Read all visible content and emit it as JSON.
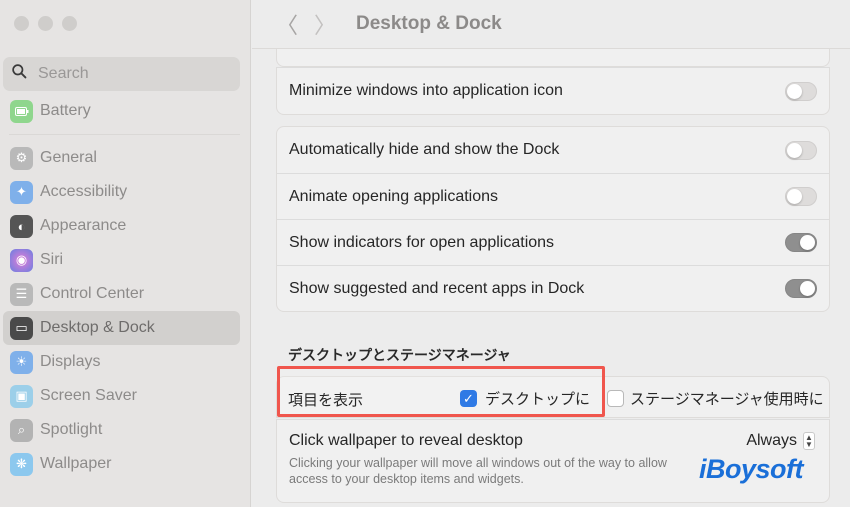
{
  "sidebar": {
    "search_placeholder": "Search",
    "items": [
      {
        "label": "Battery",
        "icon": "battery-icon",
        "color": "#5cc85a"
      },
      {
        "label": "General",
        "icon": "gear-icon",
        "color": "#9a9a9a"
      },
      {
        "label": "Accessibility",
        "icon": "accessibility-icon",
        "color": "#3d8ff0"
      },
      {
        "label": "Appearance",
        "icon": "appearance-icon",
        "color": "#2a2a2a"
      },
      {
        "label": "Siri",
        "icon": "siri-icon",
        "color": "#c04fd6"
      },
      {
        "label": "Control Center",
        "icon": "control-center-icon",
        "color": "#9a9a9a"
      },
      {
        "label": "Desktop & Dock",
        "icon": "dock-icon",
        "color": "#2a2a2a"
      },
      {
        "label": "Displays",
        "icon": "displays-icon",
        "color": "#3d8ff0"
      },
      {
        "label": "Screen Saver",
        "icon": "screen-saver-icon",
        "color": "#4fb2e6"
      },
      {
        "label": "Spotlight",
        "icon": "spotlight-icon",
        "color": "#8a8a8a"
      },
      {
        "label": "Wallpaper",
        "icon": "wallpaper-icon",
        "color": "#3fa9e8"
      }
    ],
    "active": "Desktop & Dock"
  },
  "toolbar": {
    "back": "〈",
    "forward": "〉",
    "title": "Desktop & Dock"
  },
  "dock_settings": {
    "minimize": {
      "label": "Minimize windows into application icon",
      "on": false
    },
    "rows": [
      {
        "label": "Automatically hide and show the Dock",
        "on": false
      },
      {
        "label": "Animate opening applications",
        "on": false
      },
      {
        "label": "Show indicators for open applications",
        "on": true
      },
      {
        "label": "Show suggested and recent apps in Dock",
        "on": true
      }
    ]
  },
  "desktop_stage": {
    "section_title": "デスクトップとステージマネージャ",
    "show_items_label": "項目を表示",
    "on_desktop_label": "デスクトップに",
    "on_desktop_checked": true,
    "in_stage_manager_label": "ステージマネージャ使用時に",
    "in_stage_manager_checked": false
  },
  "wallpaper_click": {
    "title": "Click wallpaper to reveal desktop",
    "description": "Clicking your wallpaper will move all windows out of the way to allow access to your desktop items and widgets.",
    "value": "Always"
  },
  "watermark": "iBoysoft",
  "colors": {
    "highlight": "#f0564d",
    "checkbox": "#2f7ae5",
    "toggle_on": "#8f8f8f"
  }
}
